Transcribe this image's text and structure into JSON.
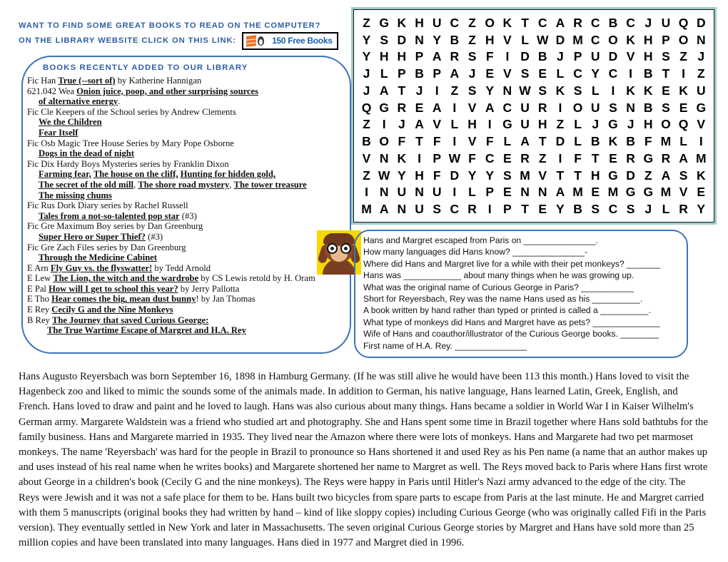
{
  "promo": {
    "line1": "Want to find some great books to read on the computer?",
    "line2": "On the library website click on this link:",
    "badge_text": "150 Free Books"
  },
  "books": {
    "heading": "Books recently added to our library",
    "entries": [
      {
        "indent": 0,
        "parts": [
          {
            "t": "Fic Han  ",
            "b": false
          },
          {
            "t": "True (--sort of)",
            "b": true
          },
          {
            "t": "  by Katherine Hannigan",
            "b": false
          }
        ]
      },
      {
        "indent": 0,
        "parts": [
          {
            "t": "621.042 Wea  ",
            "b": false
          },
          {
            "t": "Onion juice, poop, and other surprising sources",
            "b": true
          }
        ]
      },
      {
        "indent": 1,
        "parts": [
          {
            "t": "of alternative energy",
            "b": true
          },
          {
            "t": ".",
            "b": false
          }
        ]
      },
      {
        "indent": 0,
        "parts": [
          {
            "t": "Fic  Cle  Keepers of the School series by Andrew Clements",
            "b": false
          }
        ]
      },
      {
        "indent": 1,
        "parts": [
          {
            "t": "We the Children",
            "b": true
          }
        ]
      },
      {
        "indent": 1,
        "parts": [
          {
            "t": "Fear Itself",
            "b": true
          }
        ]
      },
      {
        "indent": 0,
        "parts": [
          {
            "t": "Fic Osb Magic Tree House Series by Mary Pope Osborne",
            "b": false
          }
        ]
      },
      {
        "indent": 1,
        "parts": [
          {
            "t": "Dogs in the dead of night",
            "b": true
          }
        ]
      },
      {
        "indent": 0,
        "parts": [
          {
            "t": "Fic Dix  Hardy Boys Mysteries series by Franklin Dixon",
            "b": false
          }
        ]
      },
      {
        "indent": 1,
        "parts": [
          {
            "t": "Farming fear,",
            "b": true
          },
          {
            "t": "   ",
            "b": false
          },
          {
            "t": "The house on the cliff,",
            "b": true
          },
          {
            "t": "   ",
            "b": false
          },
          {
            "t": "Hunting for hidden gold,",
            "b": true
          }
        ]
      },
      {
        "indent": 1,
        "parts": [
          {
            "t": "The secret of the old mill",
            "b": true
          },
          {
            "t": ", ",
            "b": false
          },
          {
            "t": "The shore road mystery",
            "b": true
          },
          {
            "t": ", ",
            "b": false
          },
          {
            "t": "The tower treasure",
            "b": true
          }
        ]
      },
      {
        "indent": 1,
        "parts": [
          {
            "t": "The missing chums",
            "b": true
          }
        ]
      },
      {
        "indent": 0,
        "parts": [
          {
            "t": "Fic Rus  Dork Diary series by Rachel Russell",
            "b": false
          }
        ]
      },
      {
        "indent": 1,
        "parts": [
          {
            "t": "Tales from a not-so-talented pop star",
            "b": true
          },
          {
            "t": " (#3)",
            "b": false
          }
        ]
      },
      {
        "indent": 0,
        "parts": [
          {
            "t": "Fic Gre  Maximum Boy series by Dan Greenburg",
            "b": false
          }
        ]
      },
      {
        "indent": 1,
        "parts": [
          {
            "t": "Super Hero or Super Thief?",
            "b": true
          },
          {
            "t": "  (#3)",
            "b": false
          }
        ]
      },
      {
        "indent": 0,
        "parts": [
          {
            "t": "Fic Gre  Zach Files series by Dan Greenburg",
            "b": false
          }
        ]
      },
      {
        "indent": 1,
        "parts": [
          {
            "t": "Through the Medicine Cabinet",
            "b": true
          }
        ]
      },
      {
        "indent": 0,
        "parts": [
          {
            "t": "E Arn  ",
            "b": false
          },
          {
            "t": "Fly Guy vs. the flyswatter!",
            "b": true
          },
          {
            "t": "  by Tedd Arnold",
            "b": false
          }
        ]
      },
      {
        "indent": 0,
        "parts": [
          {
            "t": "E Lew  ",
            "b": false
          },
          {
            "t": "The Lion, the witch and the wardrobe",
            "b": true
          },
          {
            "t": " by CS Lewis retold by H. Oram",
            "b": false
          }
        ]
      },
      {
        "indent": 0,
        "parts": [
          {
            "t": "E Pal  ",
            "b": false
          },
          {
            "t": "How will I get to school this year?",
            "b": true
          },
          {
            "t": " by Jerry Pallotta",
            "b": false
          }
        ]
      },
      {
        "indent": 0,
        "parts": [
          {
            "t": "E Tho  ",
            "b": false
          },
          {
            "t": "Hear comes the big, mean dust bunny",
            "b": true
          },
          {
            "t": "!  by Jan Thomas",
            "b": false
          }
        ]
      },
      {
        "indent": 0,
        "parts": [
          {
            "t": "E Rey  ",
            "b": false
          },
          {
            "t": "Cecily G and the Nine Monkeys",
            "b": true
          }
        ]
      },
      {
        "indent": 0,
        "parts": [
          {
            "t": "B Rey  ",
            "b": false
          },
          {
            "t": "The Journey that saved Curious George:",
            "b": true
          }
        ]
      },
      {
        "indent": 2,
        "parts": [
          {
            "t": "The True Wartime Escape of Margret and H.A. Rey",
            "b": true
          }
        ]
      }
    ]
  },
  "puzzle": {
    "rows": [
      "ZGKHUCZOKTCARCBCJUQD",
      "YSDNYBZHVLWDMCOKHPON",
      "YHHPARSFIDBJPUDVHSZJ",
      "JLPBPAJEVSELCYCIBTIZ",
      "JATJIZSYNWSKSLIKKEKU",
      "QGREAIVACURIOUSNBSEG",
      "ZIJAVLHIGUHZLJGJHOQV",
      "BOFTFIVFLATDLBKBFMLI",
      "VNKIPWFCERZIFTERGRAM",
      "ZWYHFDYYSMVTTHGDZASK",
      "INUNUILPENNAMEMGGMVE",
      "MANUSCRIPTEYBSCSJLRY"
    ]
  },
  "questions": {
    "items": [
      "Hans and Margret escaped from Paris on _______________.",
      "How many languages did Hans know?  _______________-",
      "Where did Hans and Margret live for a while with their pet monkeys? _______",
      "Hans was ____________ about many things when he was growing up.",
      "What was the original name of Curious George in Paris? ___________",
      "Short for Reyersbach, Rey was the name Hans used as his __________.",
      "A book written by hand rather than typed or printed is called a __________.",
      "What type of monkeys did Hans and Margret have as pets? ______________",
      "Wife of Hans and coauthor/illustrator of the Curious George books. ________",
      "First name of H.A. Rey.  _______________"
    ]
  },
  "bio": {
    "text": "Hans Augusto Reyersbach was born September 16, 1898 in Hamburg Germany.  (If he was still alive he would have been 113 this month.)  Hans loved to visit the Hagenbeck zoo and liked to mimic the sounds some of the animals made.  In addition to German, his native language, Hans learned Latin, Greek, English, and French.  Hans loved to draw and paint and he loved to laugh.  Hans was also curious about many things.  Hans became a soldier in World War I in Kaiser Wilhelm's German army.  Margarete Waldstein was a friend who studied art and photography.  She and Hans spent some time in Brazil together where Hans sold bathtubs for the family business.  Hans and  Margarete married in 1935.  They lived near the Amazon where there were lots of monkeys.  Hans and Margarete had two pet marmoset monkeys.  The name 'Reyersbach' was hard for the people in Brazil to pronounce so Hans shortened it and used Rey as his Pen name (a name that an author makes up and uses instead of his real name when he writes books) and Margarete shortened her name to Margret as well. The Reys moved back to Paris where Hans first wrote about George in  a children's book (Cecily G and the nine monkeys).  The Reys were happy in Paris until Hitler's Nazi army advanced to the edge of the city.  The Reys were Jewish and it was not a safe place for them to be.  Hans built two bicycles from spare parts to escape from Paris at the last minute.  He and Margret carried with them 5 manuscripts (original books they had written by hand – kind of like sloppy copies) including Curious George (who was originally called Fifi in the Paris version).  They eventually settled in New York and later in Massachusetts.  The seven original Curious George stories by Margret and Hans have sold more than 25 million copies and have been translated into many languages.  Hans died in 1977 and Margret died in 1996."
  },
  "colors": {
    "heading_blue": "#2e5fa3",
    "callout_border": "#3d74b8",
    "puzzle_border": "#9ec9c9",
    "monkey_bg": "#f5d900"
  }
}
